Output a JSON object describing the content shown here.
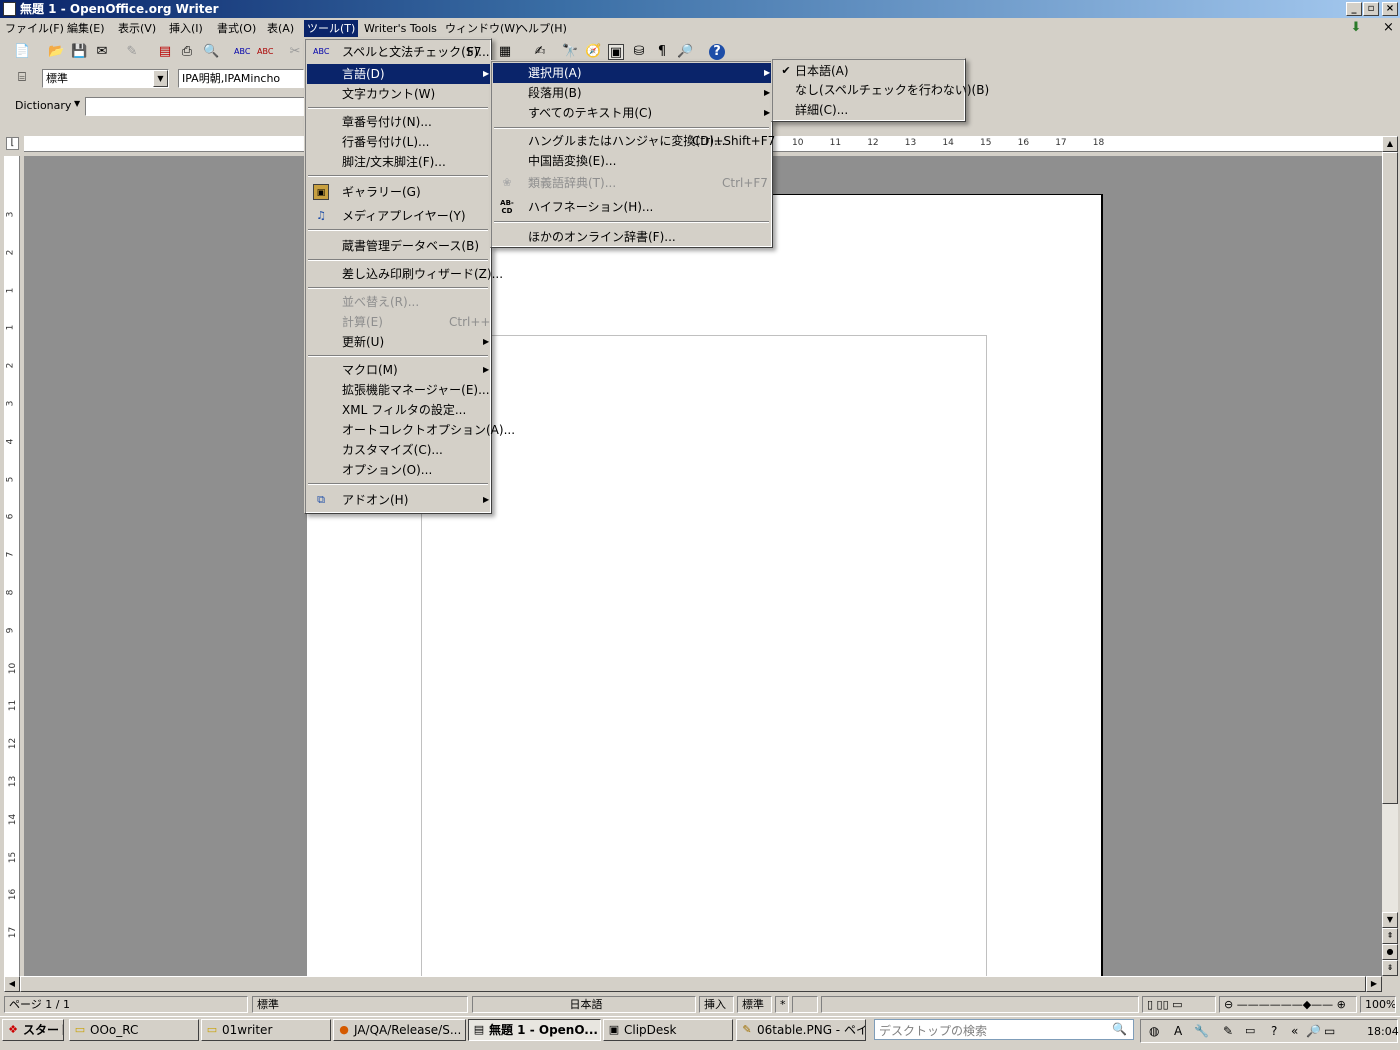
{
  "window": {
    "title": "無題 1 - OpenOffice.org Writer",
    "min": "_",
    "max": "▫",
    "close": "×"
  },
  "menubar": [
    "ファイル(F)",
    "編集(E)",
    "表示(V)",
    "挿入(I)",
    "書式(O)",
    "表(A)",
    "ツール(T)",
    "Writer's Tools",
    "ウィンドウ(W)",
    "ヘルプ(H)"
  ],
  "formatting": {
    "style": "標準",
    "font": "IPA明朝,IPAMincho"
  },
  "dictionary": {
    "label": "Dictionary",
    "value": ""
  },
  "tools_menu": {
    "items": [
      {
        "label": "スペルと文法チェック(S)...",
        "shortcut": "F7",
        "icon": "spellcheck-icon"
      },
      {
        "label": "言語(D)",
        "submenu": true
      },
      {
        "label": "文字カウント(W)"
      },
      {
        "label": "章番号付け(N)..."
      },
      {
        "label": "行番号付け(L)..."
      },
      {
        "label": "脚注/文末脚注(F)..."
      },
      {
        "label": "ギャラリー(G)",
        "icon": "gallery-icon"
      },
      {
        "label": "メディアプレイヤー(Y)",
        "icon": "media-player-icon"
      },
      {
        "label": "蔵書管理データベース(B)"
      },
      {
        "label": "差し込み印刷ウィザード(Z)..."
      },
      {
        "label": "並べ替え(R)...",
        "disabled": true
      },
      {
        "label": "計算(E)",
        "shortcut": "Ctrl++",
        "disabled": true
      },
      {
        "label": "更新(U)",
        "submenu": true
      },
      {
        "label": "マクロ(M)",
        "submenu": true
      },
      {
        "label": "拡張機能マネージャー(E)..."
      },
      {
        "label": "XML フィルタの設定..."
      },
      {
        "label": "オートコレクトオプション(A)..."
      },
      {
        "label": "カスタマイズ(C)..."
      },
      {
        "label": "オプション(O)..."
      },
      {
        "label": "アドオン(H)",
        "submenu": true,
        "icon": "addon-icon"
      }
    ]
  },
  "language_menu": {
    "items": [
      {
        "label": "選択用(A)",
        "submenu": true
      },
      {
        "label": "段落用(B)",
        "submenu": true
      },
      {
        "label": "すべてのテキスト用(C)",
        "submenu": true
      },
      {
        "label": "ハングルまたはハンジャに変換(D)...",
        "shortcut": "Ctrl+Shift+F7"
      },
      {
        "label": "中国語変換(E)..."
      },
      {
        "label": "類義語辞典(T)...",
        "shortcut": "Ctrl+F7",
        "disabled": true,
        "icon": "thesaurus-icon"
      },
      {
        "label": "ハイフネーション(H)...",
        "icon": "hyphenation-icon"
      },
      {
        "label": "ほかのオンライン辞書(F)..."
      }
    ]
  },
  "selection_menu": {
    "items": [
      {
        "label": "日本語(A)",
        "checked": true
      },
      {
        "label": "なし(スペルチェックを行わない)(B)"
      },
      {
        "label": "詳細(C)..."
      }
    ]
  },
  "ruler": {
    "h_numbers": [
      "10",
      "11",
      "12",
      "13",
      "14",
      "15",
      "16",
      "17",
      "18"
    ],
    "v_numbers": [
      "3",
      "2",
      "1",
      "1",
      "2",
      "3",
      "4",
      "5",
      "6",
      "7",
      "8",
      "9",
      "10",
      "11",
      "12",
      "13",
      "14",
      "15",
      "16",
      "17"
    ]
  },
  "statusbar": {
    "page": "ページ 1 / 1",
    "style": "標準",
    "language": "日本語",
    "insert": "挿入",
    "selection": "標準",
    "modified": "*",
    "zoom": "100%"
  },
  "taskbar": {
    "start": "スタート",
    "buttons": [
      {
        "label": "OOo_RC",
        "icon": "folder-icon"
      },
      {
        "label": "01writer",
        "icon": "folder-icon"
      },
      {
        "label": "JA/QA/Release/S...",
        "icon": "firefox-icon"
      },
      {
        "label": "無題 1 - OpenO...",
        "icon": "writer-icon",
        "pressed": true
      },
      {
        "label": "ClipDesk",
        "icon": "clipdesk-icon"
      },
      {
        "label": "06table.PNG - ペイ...",
        "icon": "paint-icon"
      }
    ],
    "search_placeholder": "デスクトップの検索",
    "clock": "18:04"
  },
  "colors": {
    "menu_highlight": "#0a246a",
    "title_gradient_start": "#0a246a",
    "doc_background": "#8f8f8f"
  }
}
